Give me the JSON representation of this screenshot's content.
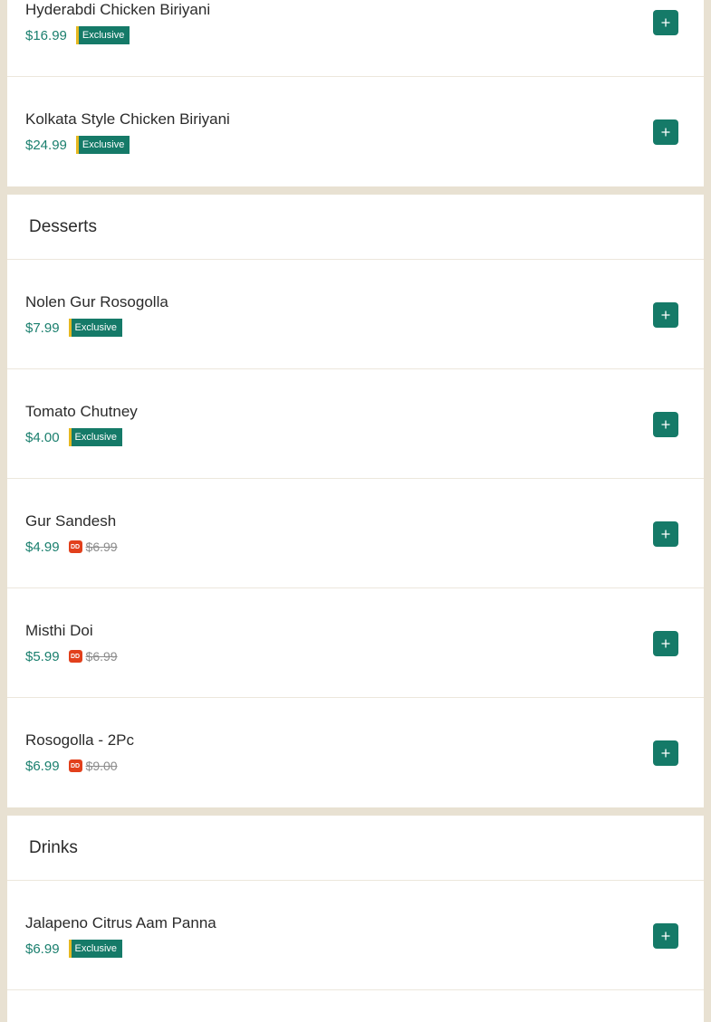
{
  "theme": {
    "accent": "#157a68",
    "price_color": "#1a7f6e",
    "badge_stripe": "#e6b820",
    "deal_icon_color": "#e2401c",
    "page_background": "#e8e1d2"
  },
  "sections": [
    {
      "title": "",
      "items": [
        {
          "name": "Hyderabdi Chicken Biriyani",
          "price": "$16.99",
          "badge": "Exclusive"
        },
        {
          "name": "Kolkata Style Chicken Biriyani",
          "price": "$24.99",
          "badge": "Exclusive"
        }
      ]
    },
    {
      "title": "Desserts",
      "items": [
        {
          "name": "Nolen Gur Rosogolla",
          "price": "$7.99",
          "badge": "Exclusive"
        },
        {
          "name": "Tomato Chutney",
          "price": "$4.00",
          "badge": "Exclusive"
        },
        {
          "name": "Gur Sandesh",
          "price": "$4.99",
          "deal_icon": "DD",
          "old_price": "$6.99"
        },
        {
          "name": "Misthi Doi",
          "price": "$5.99",
          "deal_icon": "DD",
          "old_price": "$6.99"
        },
        {
          "name": "Rosogolla - 2Pc",
          "price": "$6.99",
          "deal_icon": "DD",
          "old_price": "$9.00"
        }
      ]
    },
    {
      "title": "Drinks",
      "items": [
        {
          "name": "Jalapeno Citrus Aam Panna",
          "price": "$6.99",
          "badge": "Exclusive"
        }
      ]
    }
  ],
  "icons": {
    "add": "plus-icon",
    "deal": "dd-deal-icon"
  }
}
